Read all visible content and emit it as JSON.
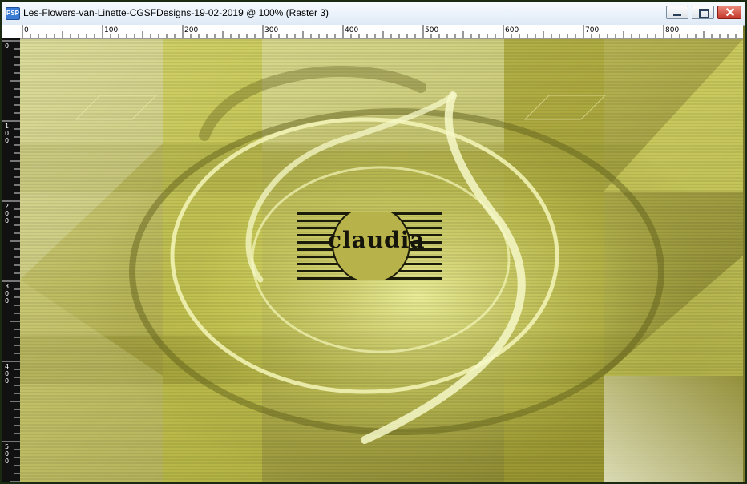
{
  "window": {
    "title": "Les-Flowers-van-Linette-CGSFDesigns-19-02-2019 @ 100% (Raster 3)",
    "app_icon_label": "PSP"
  },
  "ruler": {
    "top_labels": [
      "0",
      "100",
      "200",
      "300",
      "400",
      "500",
      "600",
      "700",
      "800"
    ],
    "left_labels": [
      "0",
      "100",
      "200",
      "300",
      "400",
      "500"
    ]
  },
  "canvas": {
    "watermark_text": "claudia"
  },
  "colors": {
    "title_bg": "#dfeaf6",
    "close_red": "#c4362a",
    "canvas_yellow": "#d4d66a",
    "canvas_olive": "#8e8a30"
  }
}
